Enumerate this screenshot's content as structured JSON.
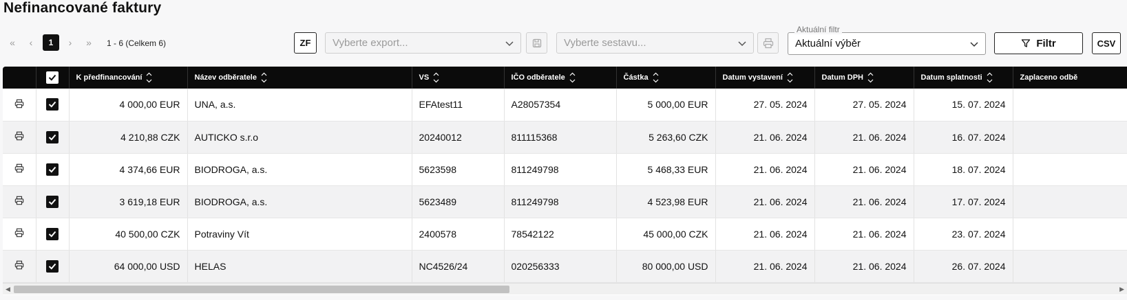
{
  "page": {
    "title": "Nefinancované faktury"
  },
  "pager": {
    "current": "1",
    "info": "1 - 6 (Celkem 6)"
  },
  "toolbar": {
    "zf_label": "ZF",
    "export_placeholder": "Vyberte export...",
    "report_placeholder": "Vyberte sestavu...",
    "filter_legend": "Aktuální filtr",
    "filter_value": "Aktuální výběr",
    "filtr_label": "Filtr",
    "csv_label": "CSV"
  },
  "table": {
    "headers": {
      "prefinance": "K předfinancování",
      "customer": "Název odběratele",
      "vs": "VS",
      "ico": "IČO odběratele",
      "amount": "Částka",
      "issued": "Datum vystavení",
      "vat_date": "Datum DPH",
      "due": "Datum splatnosti",
      "paid": "Zaplaceno odbě"
    },
    "rows": [
      {
        "prefinance": "4 000,00 EUR",
        "customer": "UNA, a.s.",
        "vs": "EFAtest11",
        "ico": "A28057354",
        "amount": "5 000,00 EUR",
        "issued": "27. 05. 2024",
        "vat_date": "27. 05. 2024",
        "due": "15. 07. 2024"
      },
      {
        "prefinance": "4 210,88 CZK",
        "customer": "AUTICKO s.r.o",
        "vs": "20240012",
        "ico": "811115368",
        "amount": "5 263,60 CZK",
        "issued": "21. 06. 2024",
        "vat_date": "21. 06. 2024",
        "due": "16. 07. 2024"
      },
      {
        "prefinance": "4 374,66 EUR",
        "customer": "BIODROGA, a.s.",
        "vs": "5623598",
        "ico": "811249798",
        "amount": "5 468,33 EUR",
        "issued": "21. 06. 2024",
        "vat_date": "21. 06. 2024",
        "due": "18. 07. 2024"
      },
      {
        "prefinance": "3 619,18 EUR",
        "customer": "BIODROGA, a.s.",
        "vs": "5623489",
        "ico": "811249798",
        "amount": "4 523,98 EUR",
        "issued": "21. 06. 2024",
        "vat_date": "21. 06. 2024",
        "due": "17. 07. 2024"
      },
      {
        "prefinance": "40 500,00 CZK",
        "customer": "Potraviny Vít",
        "vs": "2400578",
        "ico": "78542122",
        "amount": "45 000,00 CZK",
        "issued": "21. 06. 2024",
        "vat_date": "21. 06. 2024",
        "due": "23. 07. 2024"
      },
      {
        "prefinance": "64 000,00 USD",
        "customer": "HELAS",
        "vs": "NC4526/24",
        "ico": "020256333",
        "amount": "80 000,00 USD",
        "issued": "21. 06. 2024",
        "vat_date": "21. 06. 2024",
        "due": "26. 07. 2024"
      }
    ]
  }
}
